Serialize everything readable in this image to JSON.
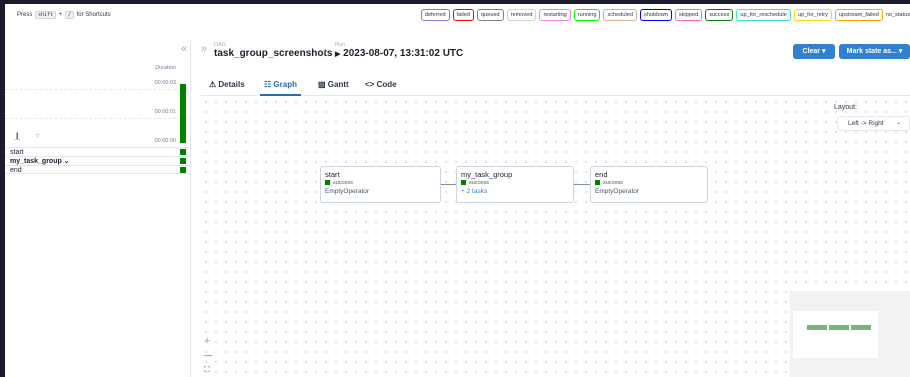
{
  "topbar": {
    "shortcut_prefix": "Press",
    "shortcut_key1": "shift",
    "shortcut_plus": "+",
    "shortcut_key2": "/",
    "shortcut_suffix": "for Shortcuts",
    "legend": [
      {
        "label": "deferred",
        "color": "#9370db"
      },
      {
        "label": "failed",
        "color": "#ff0000"
      },
      {
        "label": "queued",
        "color": "#808080"
      },
      {
        "label": "removed",
        "color": "#d3d3d3"
      },
      {
        "label": "restarting",
        "color": "#ee82ee"
      },
      {
        "label": "running",
        "color": "#00ff00"
      },
      {
        "label": "scheduled",
        "color": "#d2b48c"
      },
      {
        "label": "shutdown",
        "color": "#0000ff"
      },
      {
        "label": "skipped",
        "color": "#ff69b4"
      },
      {
        "label": "success",
        "color": "#008000"
      },
      {
        "label": "up_for_reschedule",
        "color": "#40e0d0"
      },
      {
        "label": "up_for_retry",
        "color": "#ffd700"
      },
      {
        "label": "upstream_failed",
        "color": "#ffa500"
      },
      {
        "label": "no_status",
        "color": "#ffffff"
      }
    ]
  },
  "grid": {
    "duration_title": "Duration",
    "ticks": [
      "00:00:03",
      "00:00:01",
      "00:00:00"
    ],
    "tasks": [
      {
        "label": "start",
        "bold": false,
        "status": "success"
      },
      {
        "label": "my_task_group ⌄",
        "bold": true,
        "status": "success"
      },
      {
        "label": "end",
        "bold": false,
        "status": "success"
      }
    ]
  },
  "header": {
    "dag_label": "DAG",
    "dag_id": "task_group_screenshots",
    "run_label": "Run",
    "run_id": "2023-08-07, 13:31:02 UTC",
    "clear_button": "Clear ▾",
    "mark_button": "Mark state as... ▾"
  },
  "tabs": [
    {
      "label": "Details",
      "icon": "⚠",
      "active": false
    },
    {
      "label": "Graph",
      "icon": "☷",
      "active": true
    },
    {
      "label": "Gantt",
      "icon": "▨",
      "active": false
    },
    {
      "label": "Code",
      "icon": "<>",
      "active": false
    }
  ],
  "graph": {
    "layout_label": "Layout:",
    "layout_value": "Left -> Right",
    "nodes": [
      {
        "name": "start",
        "status": "success",
        "operator": "EmptyOperator"
      },
      {
        "name": "my_task_group",
        "status": "success",
        "operator": "+ 2 tasks"
      },
      {
        "name": "end",
        "status": "success",
        "operator": "EmptyOperator"
      }
    ],
    "controls": {
      "zoom_in": "+",
      "zoom_out": "—",
      "fit": "⛶"
    }
  }
}
